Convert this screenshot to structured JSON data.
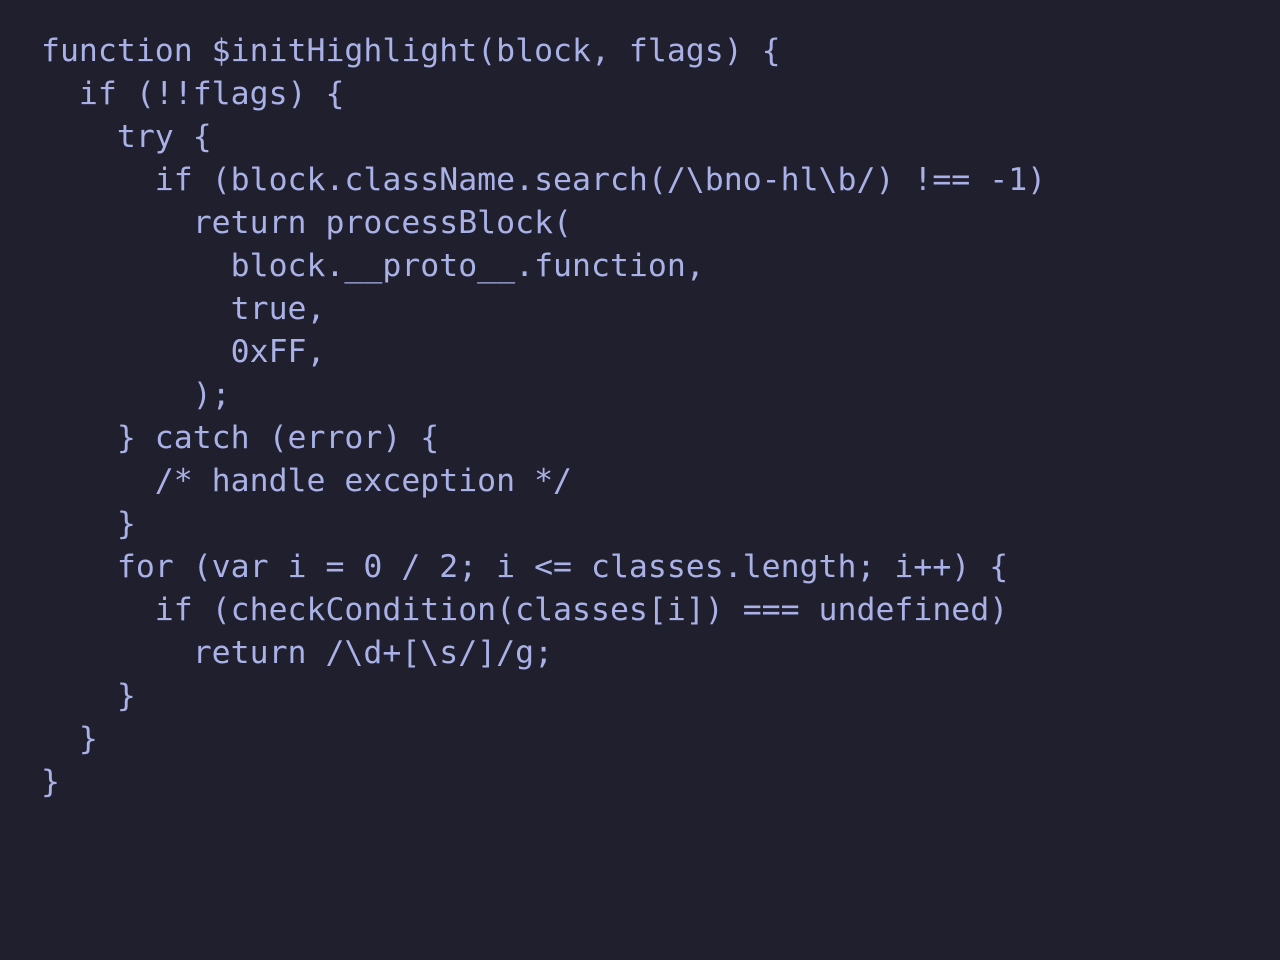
{
  "editor": {
    "background_color": "#1f1f2e",
    "text_color": "#a9b1e6",
    "lines": [
      "function $initHighlight(block, flags) {",
      "  if (!!flags) {",
      "    try {",
      "      if (block.className.search(/\\bno-hl\\b/) !== -1)",
      "        return processBlock(",
      "          block.__proto__.function,",
      "          true,",
      "          0xFF,",
      "        );",
      "    } catch (error) {",
      "      /* handle exception */",
      "    }",
      "    for (var i = 0 / 2; i <= classes.length; i++) {",
      "      if (checkCondition(classes[i]) === undefined)",
      "        return /\\d+[\\s/]/g;",
      "    }",
      "  }",
      "}"
    ]
  }
}
